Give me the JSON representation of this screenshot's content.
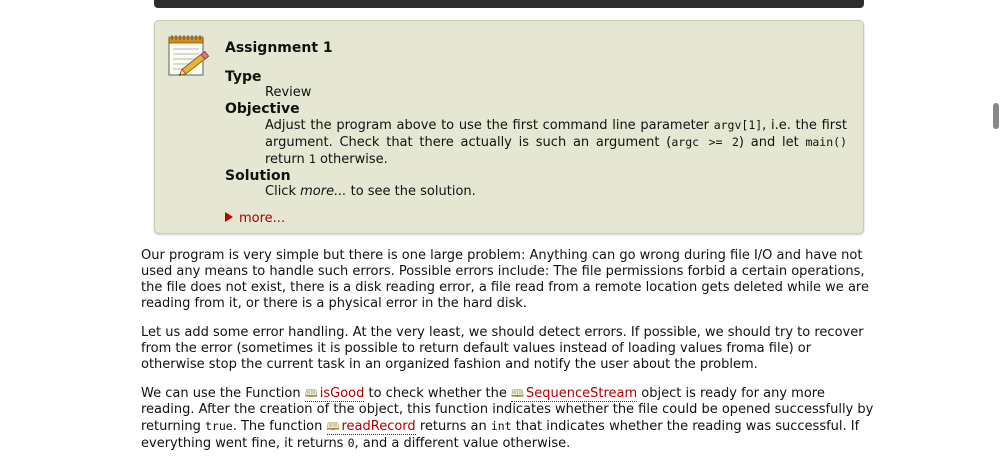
{
  "assignment": {
    "title": "Assignment 1",
    "type_label": "Type",
    "type_value": "Review",
    "objective_label": "Objective",
    "objective": {
      "t1": "Adjust the program above to use the first command line parameter ",
      "c1": "argv[1]",
      "t2": ", i.e. the first argument. Check that there actually is such an argument (",
      "c2": "argc >= 2",
      "t3": ") and let ",
      "c3": "main()",
      "t4": " return ",
      "c4": "1",
      "t5": " otherwise."
    },
    "solution_label": "Solution",
    "solution": {
      "t1": "Click ",
      "em": "more...",
      "t2": " to see the solution."
    },
    "more_label": "more..."
  },
  "body": {
    "p1": "Our program is very simple but there is one large problem: Anything can go wrong during file I/O and have not used any means to handle such errors. Possible errors include: The file permissions forbid a certain operations, the file does not exist, there is a disk reading error, a file read from a remote location gets deleted while we are reading from it, or there is a physical error in the hard disk.",
    "p2": "Let us add some error handling. At the very least, we should detect errors. If possible, we should try to recover from the error (sometimes it is possible to return default values instead of loading values froma file) or otherwise stop the current task in an organized fashion and notify the user about the problem.",
    "p3": {
      "t1": "We can use the Function ",
      "link1": "isGood",
      "t2": " to check whether the ",
      "link2": "SequenceStream",
      "t3": " object is ready for any more reading. After the creation of the object, this function indicates whether the file could be opened successfully by returning ",
      "c1": "true",
      "t4": ". The function ",
      "link3": "readRecord",
      "t5": " returns an ",
      "c2": "int",
      "t6": " that indicates whether the reading was successful. If everything went fine, it returns ",
      "c3": "0",
      "t7": ", and a different value otherwise."
    }
  },
  "icons": {
    "assignment": "notepad-pencil-icon",
    "doc_link": "open-book-icon",
    "expand": "triangle-right-icon"
  },
  "colors": {
    "box_bg": "#e5e7d2",
    "link": "#b00000"
  }
}
